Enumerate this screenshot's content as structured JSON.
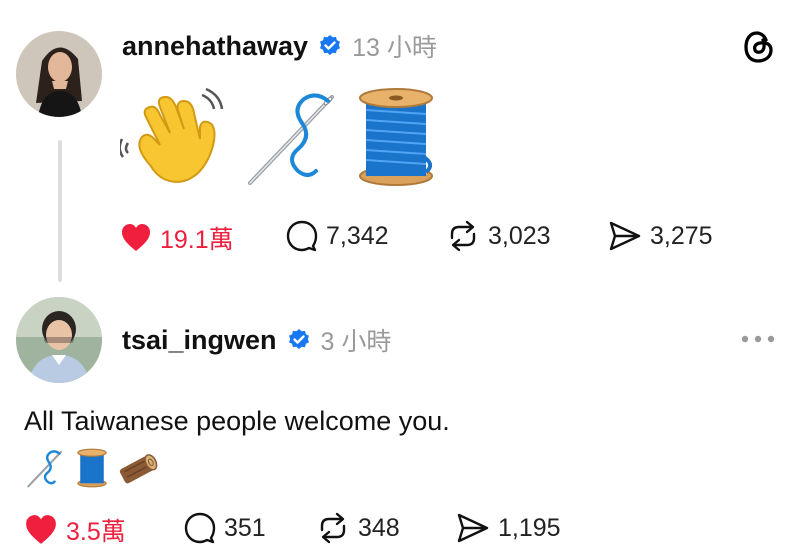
{
  "colors": {
    "like_red": "#ef1f3d",
    "verified_blue": "#1877f2",
    "muted_gray": "#9a9a9a",
    "thread_line": "#dedede"
  },
  "app_logo_icon": "threads-logo-icon",
  "posts": [
    {
      "username": "annehathaway",
      "verified": true,
      "time": "13 小時",
      "content_emoji": [
        "waving-hand-emoji",
        "sewing-needle-emoji",
        "spool-of-thread-emoji"
      ],
      "stats": {
        "likes": "19.1萬",
        "liked": true,
        "comments": "7,342",
        "reposts": "3,023",
        "shares": "3,275"
      }
    },
    {
      "username": "tsai_ingwen",
      "verified": true,
      "time": "3 小時",
      "text": "All Taiwanese people welcome you.",
      "content_emoji": [
        "sewing-needle-emoji",
        "spool-of-thread-emoji",
        "wood-emoji"
      ],
      "stats": {
        "likes": "3.5萬",
        "liked": true,
        "comments": "351",
        "reposts": "348",
        "shares": "1,195"
      }
    }
  ]
}
